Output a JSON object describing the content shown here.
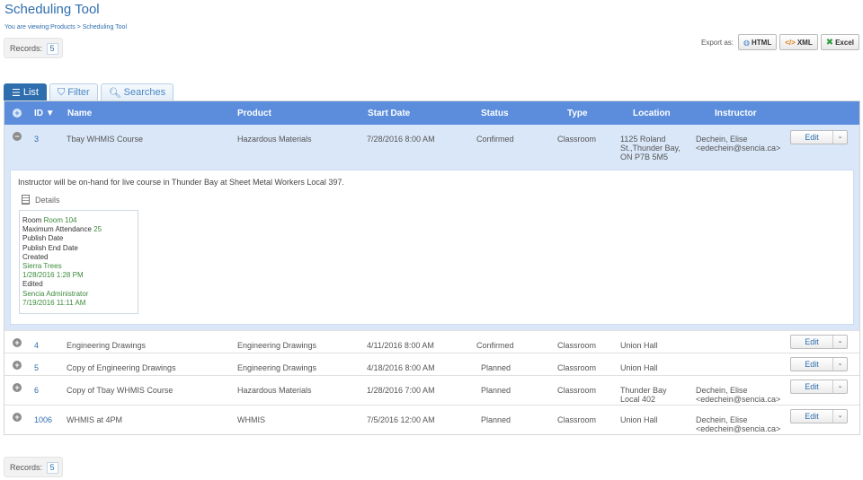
{
  "page": {
    "title": "Scheduling Tool",
    "breadcrumb": "You are viewing:Products > Scheduling Tool"
  },
  "records": {
    "label": "Records:",
    "count": "5"
  },
  "export": {
    "label": "Export as:",
    "html": "HTML",
    "xml": "XML",
    "excel": "Excel"
  },
  "tabs": [
    {
      "label": "List"
    },
    {
      "label": "Filter"
    },
    {
      "label": "Searches"
    }
  ],
  "columns": {
    "id": "ID",
    "name": "Name",
    "product": "Product",
    "start": "Start Date",
    "status": "Status",
    "type": "Type",
    "location": "Location",
    "instructor": "Instructor"
  },
  "rows": [
    {
      "toggle": "−",
      "id": "3",
      "name": "Tbay WHMIS Course",
      "product": "Hazardous Materials",
      "start": "7/28/2016 8:00 AM",
      "status": "Confirmed",
      "type": "Classroom",
      "location": "1125 Roland St.,Thunder Bay, ON P7B 5M5",
      "instructor": "Dechein, Elise <edechein@sencia.ca>",
      "edit": "Edit"
    },
    {
      "toggle": "+",
      "id": "4",
      "name": "Engineering Drawings",
      "product": "Engineering Drawings",
      "start": "4/11/2016 8:00 AM",
      "status": "Confirmed",
      "type": "Classroom",
      "location": "Union Hall",
      "instructor": "",
      "edit": "Edit"
    },
    {
      "toggle": "+",
      "id": "5",
      "name": "Copy of Engineering Drawings",
      "product": "Engineering Drawings",
      "start": "4/18/2016 8:00 AM",
      "status": "Planned",
      "type": "Classroom",
      "location": "Union Hall",
      "instructor": "",
      "edit": "Edit"
    },
    {
      "toggle": "+",
      "id": "6",
      "name": "Copy of Tbay WHMIS Course",
      "product": "Hazardous Materials",
      "start": "1/28/2016 7:00 AM",
      "status": "Planned",
      "type": "Classroom",
      "location": "Thunder Bay Local 402",
      "instructor": "Dechein, Elise <edechein@sencia.ca>",
      "edit": "Edit"
    },
    {
      "toggle": "+",
      "id": "1006",
      "name": "WHMIS at 4PM",
      "product": "WHMIS",
      "start": "7/5/2016 12:00 AM",
      "status": "Planned",
      "type": "Classroom",
      "location": "Union Hall",
      "instructor": "Dechein, Elise <edechein@sencia.ca>",
      "edit": "Edit"
    }
  ],
  "detail": {
    "description": "Instructor will be on-hand for live course in Thunder Bay at Sheet Metal Workers Local 397.",
    "heading": "Details",
    "room_label": "Room",
    "room": "Room 104",
    "max_label": "Maximum Attendance",
    "max": "25",
    "publish_date_label": "Publish Date",
    "publish_end_label": "Publish End Date",
    "created_label": "Created",
    "created_by": "Sierra Trees",
    "created_at": "1/28/2016 1:28 PM",
    "edited_label": "Edited",
    "edited_by": "Sencia Administrator",
    "edited_at": "7/19/2016 11:11 AM"
  },
  "colors": {
    "accent": "#2f6eae",
    "header": "#5b8ddc",
    "expanded_row": "#d9e7f8",
    "value_green": "#3b8a3b"
  }
}
